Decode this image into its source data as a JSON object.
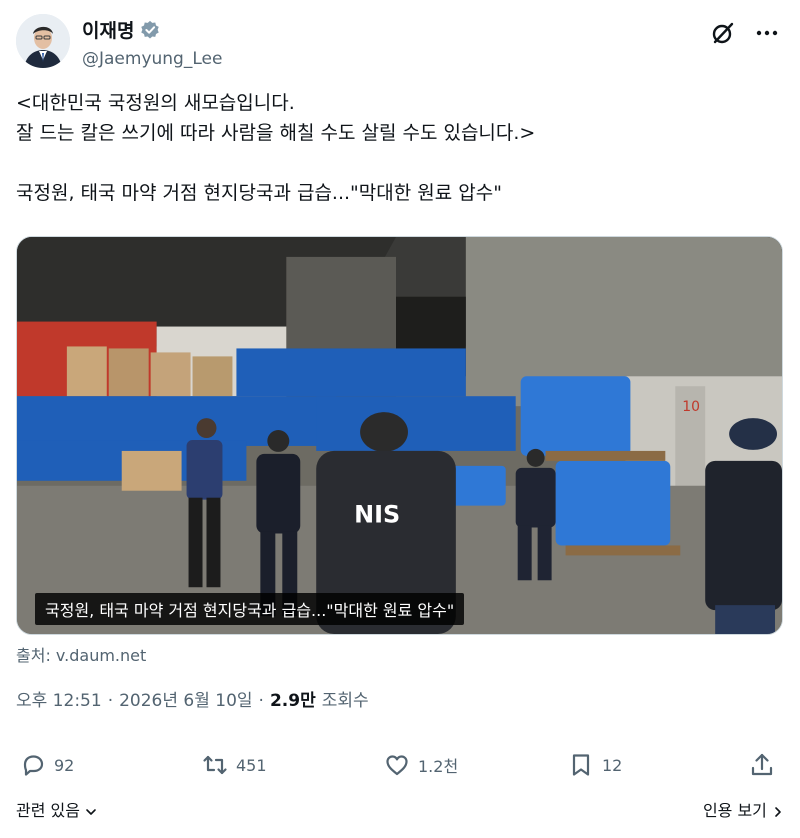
{
  "user": {
    "display_name": "이재명",
    "handle": "@Jaemyung_Lee",
    "avatar_icon": "profile-avatar",
    "verified_icon": "verified-badge-icon"
  },
  "tweet": {
    "line1": "<대한민국 국정원의 새모습입니다.",
    "line2": "잘 드는 칼은 쓰기에 따라 사람을 해칠 수도 살릴 수도 있습니다.>",
    "line3": "국정원, 태국 마약 거점 현지당국과 급습...\"막대한 원료 압수\""
  },
  "media": {
    "caption": "국정원, 태국 마약 거점 현지당국과 급습...\"막대한 원료 압수\"",
    "vest_text": "NIS",
    "door_text": "10"
  },
  "source": "출처: v.daum.net",
  "meta": {
    "time": "오후 12:51",
    "sep": "·",
    "date": "2026년 6월 10일",
    "views": "2.9만",
    "views_label": "조회수"
  },
  "actions": {
    "replies": "92",
    "reposts": "451",
    "likes": "1.2천",
    "bookmarks": "12"
  },
  "footer": {
    "related": "관련 있음",
    "quotes": "인용 보기"
  },
  "colors": {
    "secondary_text": "#536471",
    "primary_text": "#0f1419",
    "border": "#cfd9de"
  }
}
